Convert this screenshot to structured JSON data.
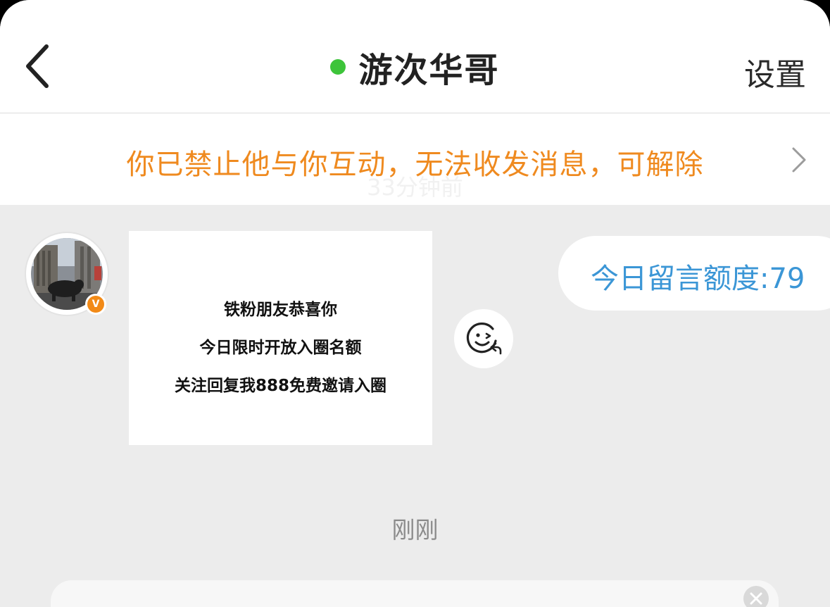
{
  "header": {
    "title": "游次华哥",
    "settings_label": "设置",
    "online_color": "#3dc43a"
  },
  "banner": {
    "text": "你已禁止他与你互动，无法收发消息，可解除",
    "ghost_time": "33分钟前",
    "text_color": "#ef8a1f"
  },
  "messages": {
    "incoming_card": {
      "lines": [
        "铁粉朋友恭喜你",
        "今日限时开放入圈名额",
        "关注回复我888免费邀请入圈"
      ]
    },
    "outgoing_bubble": {
      "text": "今日留言额度:79",
      "text_color": "#3b96d6"
    },
    "avatar_badge": "V"
  },
  "timestamp": "刚刚",
  "icons": [
    "back-chevron-icon",
    "right-chevron-icon",
    "emoji-reply-icon",
    "close-icon"
  ]
}
